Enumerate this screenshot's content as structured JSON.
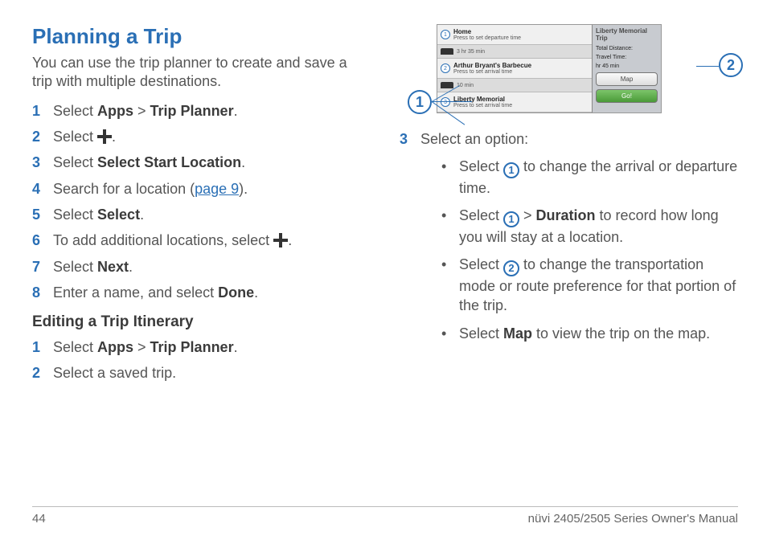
{
  "left": {
    "title": "Planning a Trip",
    "intro": "You can use the trip planner to create and save a trip with multiple destinations.",
    "steps": [
      {
        "pre": "Select ",
        "b1": "Apps",
        "mid": " > ",
        "b2": "Trip Planner",
        "post": "."
      },
      {
        "pre": "Select ",
        "icon": "plus",
        "post": "."
      },
      {
        "pre": "Select ",
        "b1": "Select Start Location",
        "post": "."
      },
      {
        "pre": "Search for a location (",
        "link": "page 9",
        "post": ")."
      },
      {
        "pre": "Select ",
        "b1": "Select",
        "post": "."
      },
      {
        "pre": "To add additional locations, select ",
        "icon": "plus",
        "post": "."
      },
      {
        "pre": "Select ",
        "b1": "Next",
        "post": "."
      },
      {
        "pre": "Enter a name, and select ",
        "b1": "Done",
        "post": "."
      }
    ],
    "sub": "Editing a Trip Itinerary",
    "steps2": [
      {
        "pre": "Select ",
        "b1": "Apps",
        "mid": " > ",
        "b2": "Trip Planner",
        "post": "."
      },
      {
        "pre": "Select a saved trip."
      }
    ]
  },
  "right": {
    "shot": {
      "rows": [
        {
          "n": "1",
          "title": "Home",
          "sub": "Press to set departure time"
        },
        {
          "dur": "3 hr 35 min"
        },
        {
          "n": "2",
          "title": "Arthur Bryant's Barbecue",
          "sub": "Press to set arrival time"
        },
        {
          "dur": "10 min"
        },
        {
          "n": "3",
          "title": "Liberty Memorial",
          "sub": "Press to set arrival time"
        }
      ],
      "panel": {
        "title": "Liberty Memorial Trip",
        "dist_label": "Total Distance:",
        "time_label": "Travel Time:",
        "time_val": "hr 45 min",
        "map": "Map",
        "go": "Go!"
      }
    },
    "callouts": {
      "c1": "1",
      "c2": "2"
    },
    "step3": {
      "num": "3",
      "lead": "Select an option:",
      "bullets": [
        {
          "pre": "Select ",
          "c": "1",
          "post": " to change the arrival or departure time."
        },
        {
          "pre": "Select ",
          "c": "1",
          "mid": " > ",
          "b": "Duration",
          "post": " to record how long you will stay at a location."
        },
        {
          "pre": "Select ",
          "c": "2",
          "post": " to change the transportation mode or route preference for that portion of the trip."
        },
        {
          "pre": "Select ",
          "b": "Map",
          "post": " to view the trip on the map."
        }
      ]
    }
  },
  "footer": {
    "page": "44",
    "manual": "nüvi 2405/2505 Series Owner's Manual"
  }
}
